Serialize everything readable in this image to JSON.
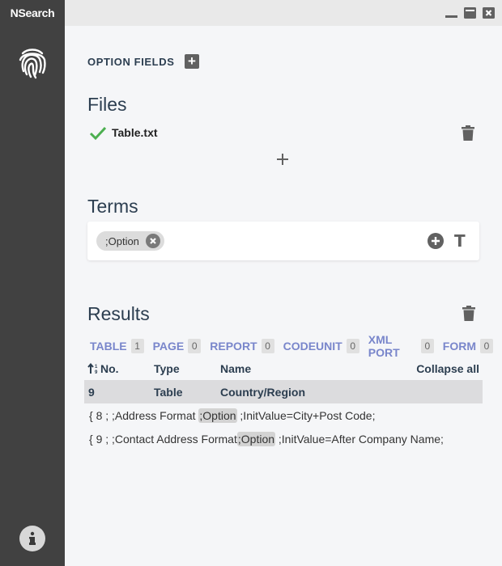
{
  "app": {
    "title": "NSearch"
  },
  "window_controls": {
    "minimize": "minimize-icon",
    "maximize": "maximize-icon",
    "close": "close-icon"
  },
  "option_fields": {
    "label": "OPTION FIELDS",
    "add_icon": "+"
  },
  "files": {
    "title": "Files",
    "items": [
      {
        "name": "Table.txt",
        "status": "loaded"
      }
    ],
    "add_icon": "+"
  },
  "terms": {
    "title": "Terms",
    "chips": [
      {
        "label": ";Option"
      }
    ],
    "text_icon": "T"
  },
  "results": {
    "title": "Results",
    "tabs": [
      {
        "label": "TABLE",
        "count": "1"
      },
      {
        "label": "PAGE",
        "count": "0"
      },
      {
        "label": "REPORT",
        "count": "0"
      },
      {
        "label": "CODEUNIT",
        "count": "0"
      },
      {
        "label": "XML PORT",
        "count": "0"
      },
      {
        "label": "FORM",
        "count": "0"
      }
    ],
    "columns": {
      "no": "No.",
      "type": "Type",
      "name": "Name",
      "collapse_all": "Collapse all"
    },
    "rows": [
      {
        "no": "9",
        "type": "Table",
        "name": "Country/Region",
        "details": [
          {
            "before": "{ 8 ; ;Address Format ",
            "match": ";Option",
            "after": " ;InitValue=City+Post Code;"
          },
          {
            "before": "{ 9 ; ;Contact Address Format",
            "match": ";Option",
            "after": " ;InitValue=After Company Name;"
          }
        ]
      }
    ]
  },
  "colors": {
    "sidebar": "#414141",
    "accent": "#7986cb",
    "success": "#4caf50",
    "heading": "#2c3e50"
  }
}
